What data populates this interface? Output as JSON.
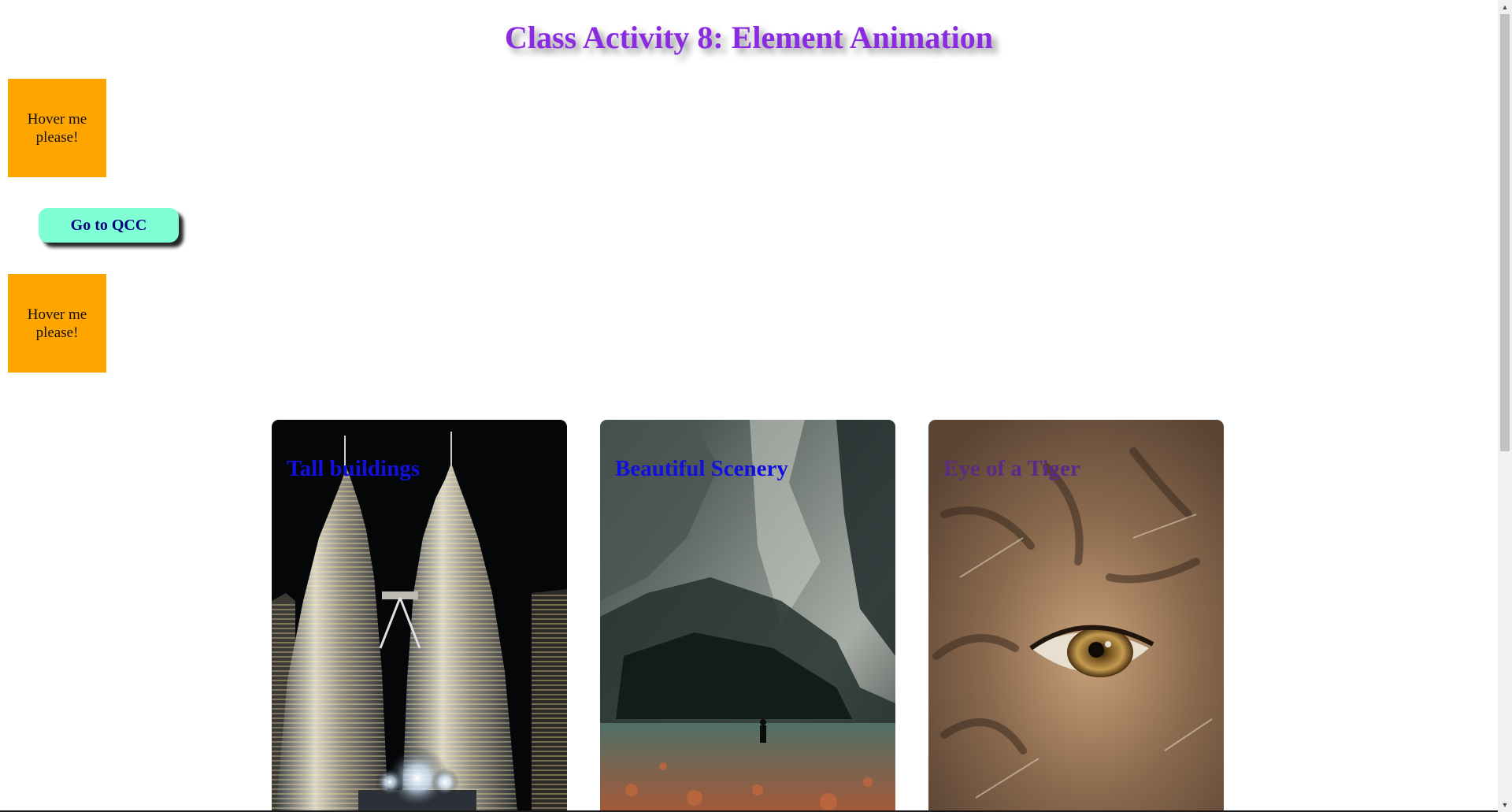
{
  "page": {
    "title": "Class Activity 8: Element Animation"
  },
  "hover_boxes": [
    {
      "label": "Hover me please!"
    },
    {
      "label": "Hover me please!"
    }
  ],
  "qcc_button": {
    "label": "Go to QCC"
  },
  "cards": [
    {
      "title": "Tall buildings",
      "image": "petronas-towers-night-photo"
    },
    {
      "title": "Beautiful Scenery",
      "image": "rocky-cave-forest-photo"
    },
    {
      "title": "Eye of a Tiger",
      "image": "tiger-eye-closeup-photo"
    }
  ],
  "colors": {
    "title": "#8a2be2",
    "hover_box": "#ffa500",
    "button_bg": "#7fffd4",
    "button_text": "#000080",
    "card_title": "#1010e0"
  },
  "scrollbar": {
    "up_icon": "arrow-up-icon",
    "down_icon": "arrow-down-icon"
  }
}
